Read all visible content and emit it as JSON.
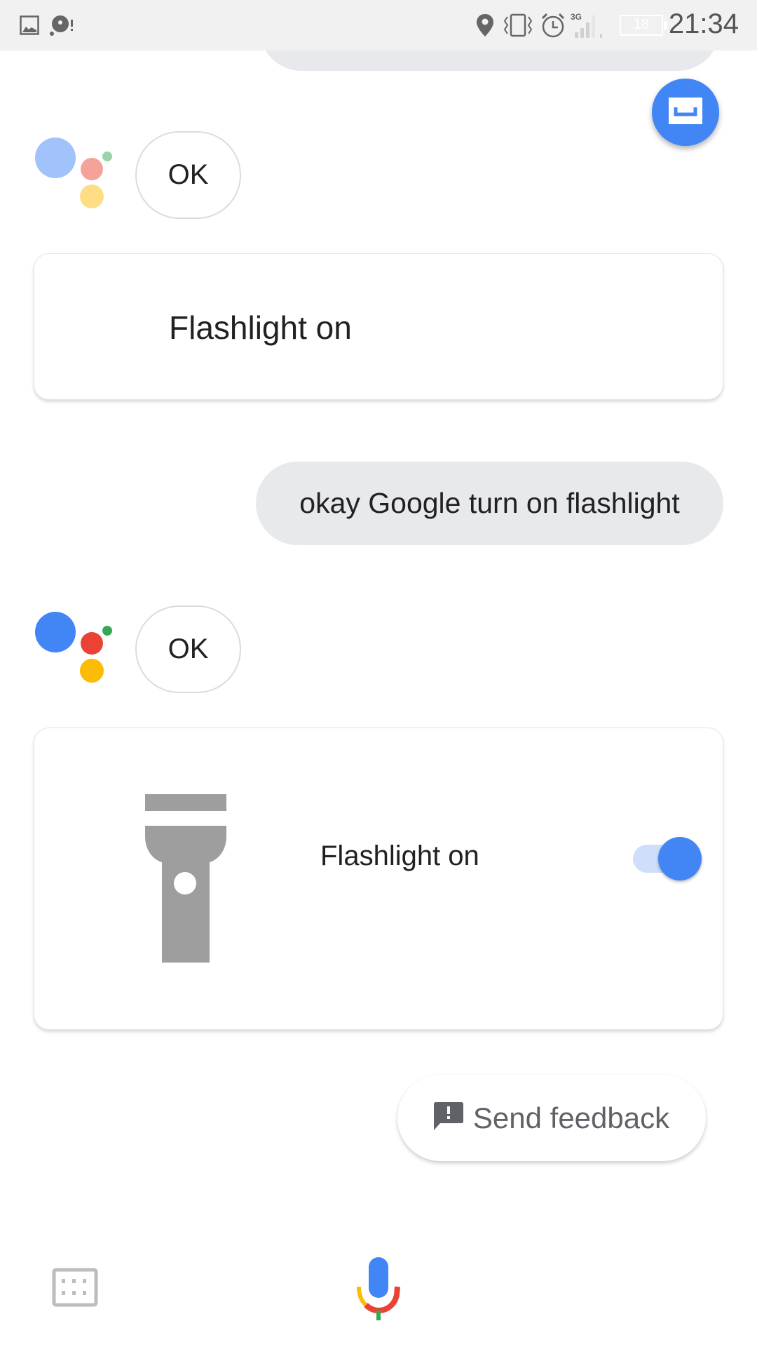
{
  "status_bar": {
    "time": "21:34",
    "battery_level": "18",
    "network_type": "3G",
    "icons": [
      "gallery-icon",
      "sync-alert-icon",
      "location-icon",
      "vibrate-icon",
      "alarm-icon",
      "signal-icon",
      "battery-icon"
    ]
  },
  "conversation": {
    "assistant_reply_1": "OK",
    "card_1": {
      "title": "Flashlight on"
    },
    "user_query": "okay Google turn on flashlight",
    "assistant_reply_2": "OK",
    "card_2": {
      "title": "Flashlight on",
      "icon": "flashlight-icon",
      "toggle_on": true
    }
  },
  "actions": {
    "send_feedback_label": "Send feedback",
    "keyboard_icon": "keyboard-icon",
    "mic_icon": "mic-icon",
    "fab_icon": "snapshot-icon"
  },
  "colors": {
    "accent_blue": "#4285f4",
    "google_red": "#ea4335",
    "google_yellow": "#fbbc05",
    "google_green": "#34a853",
    "bubble_gray": "#e8e9ec"
  }
}
